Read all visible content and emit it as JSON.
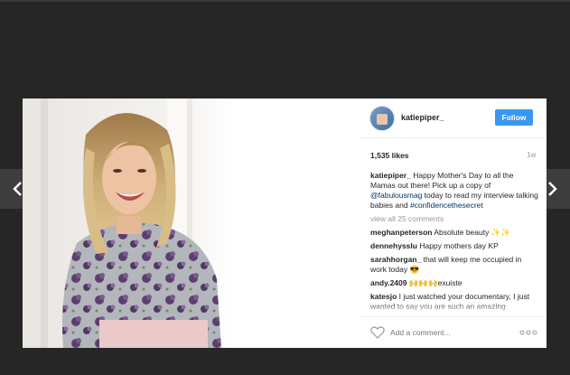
{
  "post": {
    "username": "katiepiper_",
    "follow_label": "Follow",
    "likes": "1,535 likes",
    "time": "1w",
    "caption": {
      "user": "katiepiper_",
      "text1": " Happy Mother's Day to all the Mamas out there! Pick up a copy of ",
      "mention": "@fabulousmag",
      "text2": " today to read my interview talking babies and ",
      "hashtag": "#confidencethesecret"
    },
    "view_all": "view all 25 comments",
    "comments": [
      {
        "user": "meghanpeterson",
        "text": " Absolute beauty ✨✨"
      },
      {
        "user": "dennehysslu",
        "text": " Happy mothers day KP"
      },
      {
        "user": "sarahhorgan_",
        "text": " that will keep me occupied in work today 😎"
      },
      {
        "user": "andy.2409",
        "text": " 🙌🙌🙌exuiste"
      },
      {
        "user": "katesjo",
        "text": " I just watched your documentary, I just wanted to say you are such an amazing"
      }
    ],
    "add_comment_placeholder": "Add a comment..."
  },
  "colors": {
    "background": "#262626",
    "follow_button": "#3897f0",
    "link": "#003569"
  },
  "icons": [
    "chevron-left-icon",
    "chevron-right-icon",
    "heart-icon",
    "more-options-icon"
  ]
}
